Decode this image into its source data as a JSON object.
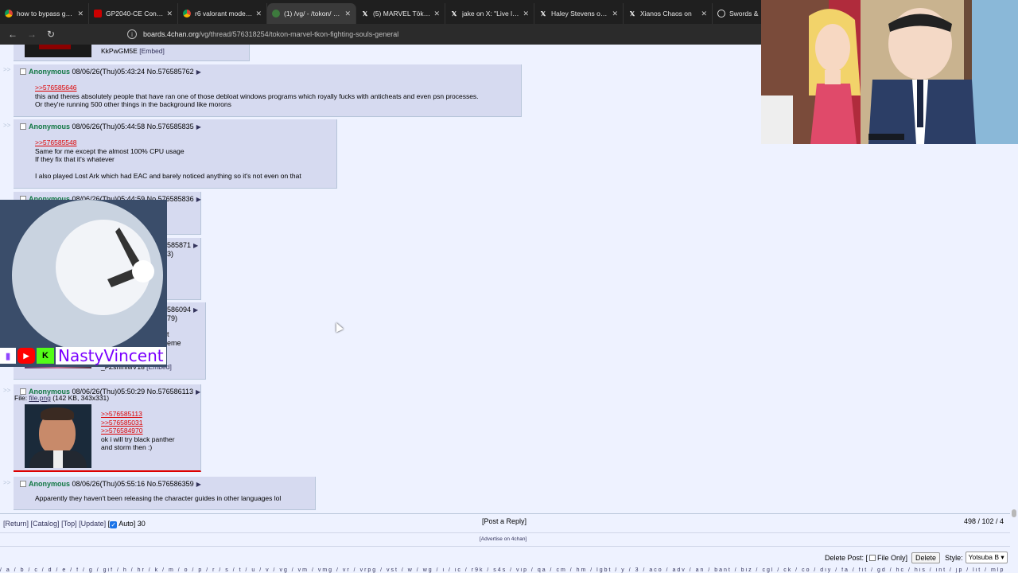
{
  "browser": {
    "tabs": [
      {
        "title": "how to bypass game",
        "favicon": "chrome-icon"
      },
      {
        "title": "GP2040-CE Configu",
        "favicon": "gp-icon"
      },
      {
        "title": "r6 valorant mode - C",
        "favicon": "chrome-icon"
      },
      {
        "title": "(1) /vg/ - /tokon/ - M",
        "favicon": "clover-icon",
        "active": true
      },
      {
        "title": "(5) MARVEL Tōkon: F",
        "favicon": "x-icon"
      },
      {
        "title": "jake on X: \"Live look",
        "favicon": "x-icon"
      },
      {
        "title": "Haley Stevens on X:",
        "favicon": "x-icon"
      },
      {
        "title": "Xianos Chaos on",
        "favicon": "x-icon"
      },
      {
        "title": "Swords &",
        "favicon": "circle-icon"
      }
    ],
    "url_host": "boards.4chan.org",
    "url_path": "/vg/thread/576318254/tokon-marvel-tkon-fighting-souls-general"
  },
  "posts": [
    {
      "id": "top",
      "partial_text": "KkPwGM5E",
      "embed": "[Embed]"
    },
    {
      "id": "p1",
      "name": "Anonymous",
      "datetime": "08/06/26(Thu)05:43:24",
      "no": "No.576585762",
      "quote1": ">>576585646",
      "line1": "this and theres absolutely people that have ran one of those debloat windows programs which royally fucks with anticheats and even psn processes.",
      "line2": "Or they're running 500 other things in the background like morons"
    },
    {
      "id": "p2",
      "name": "Anonymous",
      "datetime": "08/06/26(Thu)05:44:58",
      "no": "No.576585835",
      "quote1": ">>576585548",
      "line1": "Same for me except the almost 100% CPU usage",
      "line2": "If they fix that it's whatever",
      "line3": "I also played Lost Ark which had EAC and barely noticed anything so it's not even on that"
    },
    {
      "id": "p3",
      "name": "Anonymous",
      "datetime": "08/06/26(Thu)05:44:59",
      "no": "No.576585836"
    },
    {
      "id": "p4",
      "no_partial": "585871",
      "frag": "3)"
    },
    {
      "id": "p5",
      "no_partial": "586094",
      "frag1": "79)",
      "frag2": "t",
      "frag3": "eme",
      "embed_text": "_FZsnmfwV18",
      "embed": "[Embed]"
    },
    {
      "id": "p6",
      "name": "Anonymous",
      "datetime": "08/06/26(Thu)05:50:29",
      "no": "No.576586113",
      "file_label": "File:",
      "file_name": "file.png",
      "file_meta": "(142 KB, 343x331)",
      "quote1": ">>576585113",
      "quote2": ">>576585031",
      "quote3": ">>576584970",
      "line1": "ok i will try black panther",
      "line2": "and storm then :)"
    },
    {
      "id": "p7",
      "name": "Anonymous",
      "datetime": "08/06/26(Thu)05:55:16",
      "no": "No.576586359",
      "line1": "Apparently they haven't been releasing the character guides in other languages lol"
    }
  ],
  "footer": {
    "return": "[Return]",
    "catalog": "[Catalog]",
    "top": "[Top]",
    "update": "[Update]",
    "auto_prefix": "[",
    "auto": "Auto]",
    "auto_count": "30",
    "post_reply": "[Post a Reply]",
    "stats": "498 / 102 / 4",
    "advertise": "[Advertise on 4chan]",
    "delete_post": "Delete Post: [",
    "file_only": "File Only]",
    "delete_btn": "Delete",
    "style_label": "Style:",
    "style_value": "Yotsuba B"
  },
  "stream": {
    "streamer": "NastyVincent"
  },
  "colors": {
    "name_green": "#117743",
    "quote_red": "#dd0000",
    "post_bg": "#d6daf0",
    "page_bg": "#eef2ff"
  }
}
